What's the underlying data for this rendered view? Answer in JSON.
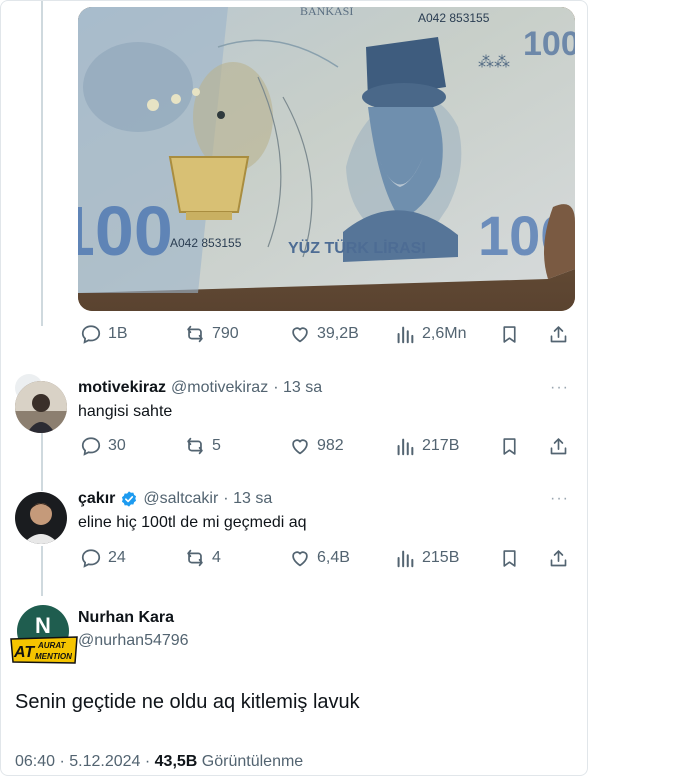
{
  "banknote": {
    "bank_text": "BANKASI",
    "serial_top": "A042 853155",
    "serial_bottom": "A042 853155",
    "denomination_text": "YÜZ TÜRK LİRASI",
    "value": "100"
  },
  "post_actions": {
    "replies": "1B",
    "reposts": "790",
    "likes": "39,2B",
    "views": "2,6Mn"
  },
  "replies": [
    {
      "name": "motivekiraz",
      "handle": "@motivekiraz",
      "time": "· 13 sa",
      "text": "hangisi sahte",
      "verified": false,
      "stats": {
        "replies": "30",
        "reposts": "5",
        "likes": "982",
        "views": "217B"
      }
    },
    {
      "name": "çakır",
      "handle": "@saltcakir",
      "time": "· 13 sa",
      "text": "eline hiç 100tl de mi geçmedi aq",
      "verified": true,
      "stats": {
        "replies": "24",
        "reposts": "4",
        "likes": "6,4B",
        "views": "215B"
      }
    }
  ],
  "more_glyph": "···",
  "main_post": {
    "name": "Nurhan Kara",
    "handle": "@nurhan54796",
    "avatar_initial": "N",
    "text": "Senin geçtide ne oldu aq kitlemiş lavuk",
    "time": "06:40 · 5.12.2024 · ",
    "views_count": "43,5B",
    "views_label": " Görüntülenme"
  },
  "watermark": {
    "line1": "AURAT",
    "line2": "MENTION",
    "prefix": "AT"
  },
  "colors": {
    "verified": "#1d9bf0",
    "muted": "#536471",
    "line": "#cfd9de"
  }
}
